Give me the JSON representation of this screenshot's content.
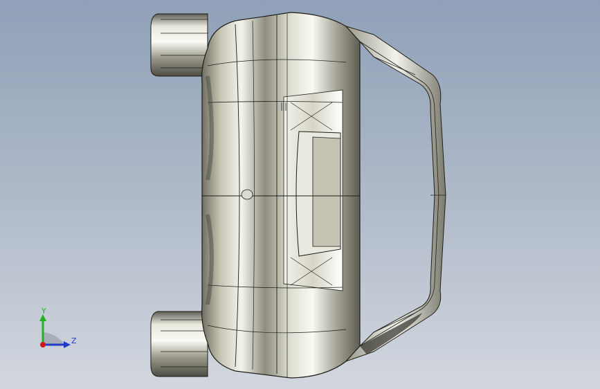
{
  "viewport": {
    "background_top": "#8fa0b8",
    "background_bottom": "#d2d7df"
  },
  "model": {
    "body_color": "#c9c8b8",
    "edge_color": "#1e1e18"
  },
  "triad": {
    "y_label": "Y",
    "z_label": "Z",
    "y_color": "#1fb31f",
    "z_color": "#1f3cc8",
    "x_color": "#d01818"
  }
}
